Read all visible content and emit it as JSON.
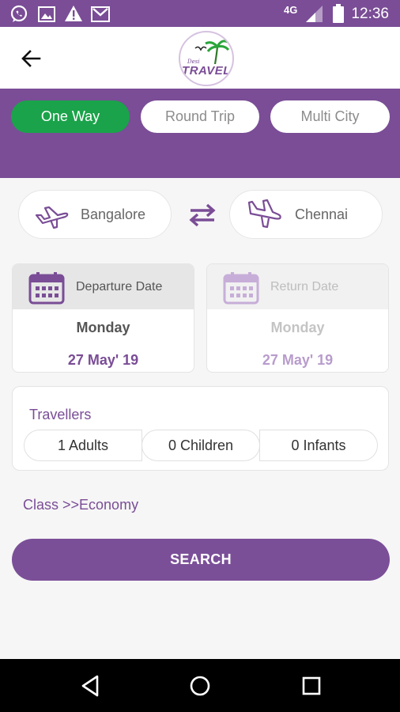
{
  "status_bar": {
    "network": "4G",
    "time": "12:36",
    "icons": [
      "whatsapp-icon",
      "image-icon",
      "warning-icon",
      "gmail-icon",
      "signal-icon",
      "battery-icon"
    ]
  },
  "app_bar": {
    "back_icon": "arrow-left-icon",
    "logo_small_text": "Desi",
    "logo_text": "TRAVEL"
  },
  "trip_types": [
    {
      "label": "One Way",
      "active": true
    },
    {
      "label": "Round Trip",
      "active": false
    },
    {
      "label": "Multi City",
      "active": false
    }
  ],
  "route": {
    "from": {
      "city": "Bangalore",
      "icon": "plane-takeoff-icon"
    },
    "to": {
      "city": "Chennai",
      "icon": "plane-landing-icon"
    },
    "swap_icon": "swap-arrows-icon"
  },
  "dates": {
    "departure": {
      "label": "Departure Date",
      "day": "Monday",
      "date": "27 May' 19",
      "enabled": true
    },
    "return": {
      "label": "Return Date",
      "day": "Monday",
      "date": "27 May' 19",
      "enabled": false
    }
  },
  "travellers": {
    "title": "Travellers",
    "adults": "1 Adults",
    "children": "0 Children",
    "infants": "0 Infants"
  },
  "class_link": "Class >>Economy",
  "search_label": "SEARCH",
  "colors": {
    "primary": "#7a4d96",
    "active_green": "#1aa34a",
    "background": "#f6f6f6"
  },
  "nav_bar": {
    "icons": [
      "back-triangle-icon",
      "home-circle-icon",
      "recents-square-icon"
    ]
  }
}
